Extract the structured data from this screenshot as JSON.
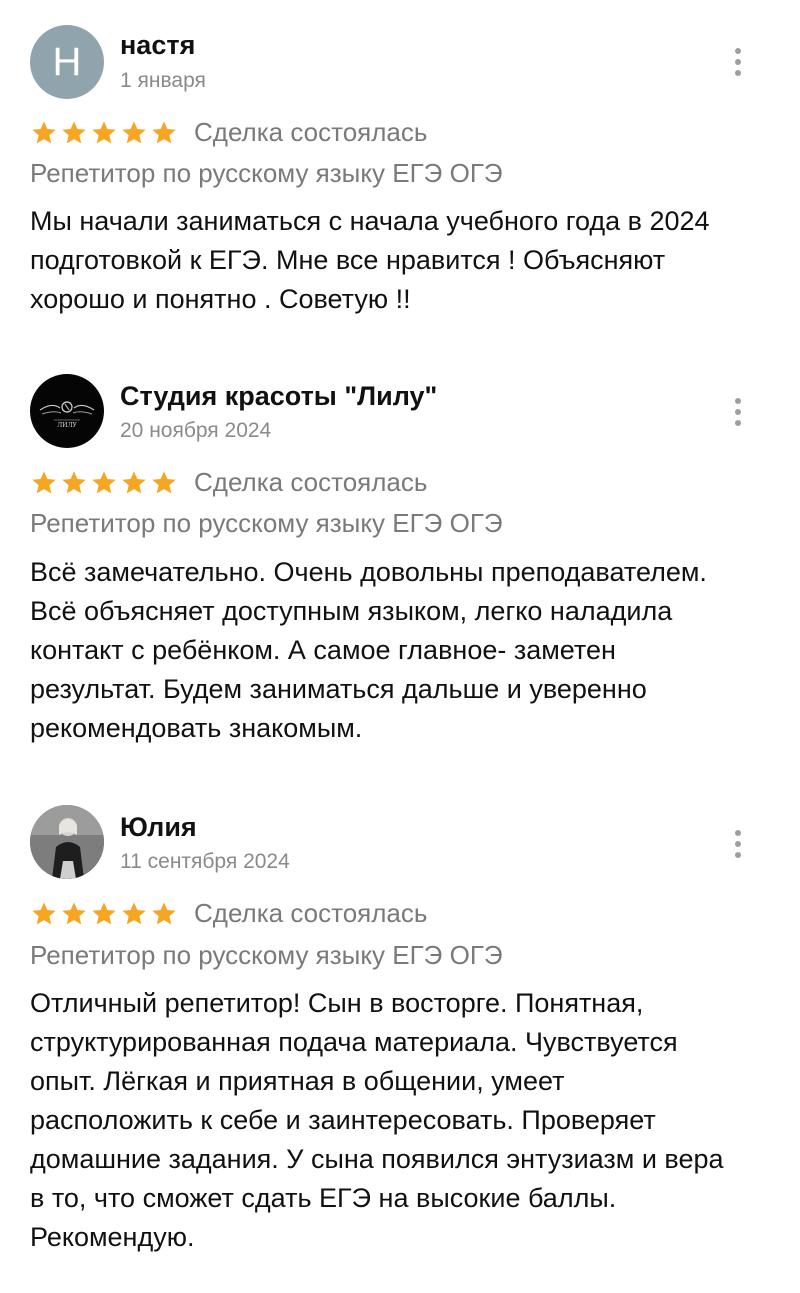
{
  "colors": {
    "star": "#f6a623",
    "muted": "#7a7a7a",
    "avatar_letter_bg": "#90a4ae"
  },
  "reviews": [
    {
      "author": "настя",
      "avatar_letter": "Н",
      "date": "1 января",
      "rating": 5,
      "status": "Сделка состоялась",
      "category": "Репетитор по русскому языку ЕГЭ ОГЭ",
      "text_lines": [
        "Мы начали заниматься с начала учебного года в  2024",
        "подготовкой к ЕГЭ. Мне все нравится ! Объясняют",
        "хорошо и понятно . Советую !!"
      ]
    },
    {
      "author": "Студия красоты \"Лилу\"",
      "avatar_text": "ЛИЛУ",
      "date": "20 ноября 2024",
      "rating": 5,
      "status": "Сделка состоялась",
      "category": "Репетитор по русскому языку ЕГЭ ОГЭ",
      "text_lines": [
        "Всё замечательно. Очень довольны преподавателем.",
        "Всё объясняет доступным языком, легко наладила",
        "контакт с ребёнком. А самое главное- заметен",
        "результат. Будем заниматься дальше и уверенно",
        "рекомендовать знакомым."
      ]
    },
    {
      "author": "Юлия",
      "date": "11 сентября 2024",
      "rating": 5,
      "status": "Сделка состоялась",
      "category": "Репетитор по русскому языку ЕГЭ ОГЭ",
      "text_lines": [
        "Отличный репетитор! Сын  в восторге. Понятная,",
        "структурированная подача материала. Чувствуется",
        "опыт. Лёгкая и приятная в общении, умеет",
        "расположить к себе и заинтересовать. Проверяет",
        "домашние задания.  У сына появился энтузиазм и вера",
        "в то, что сможет сдать ЕГЭ  на высокие баллы.",
        "Рекомендую."
      ]
    }
  ]
}
